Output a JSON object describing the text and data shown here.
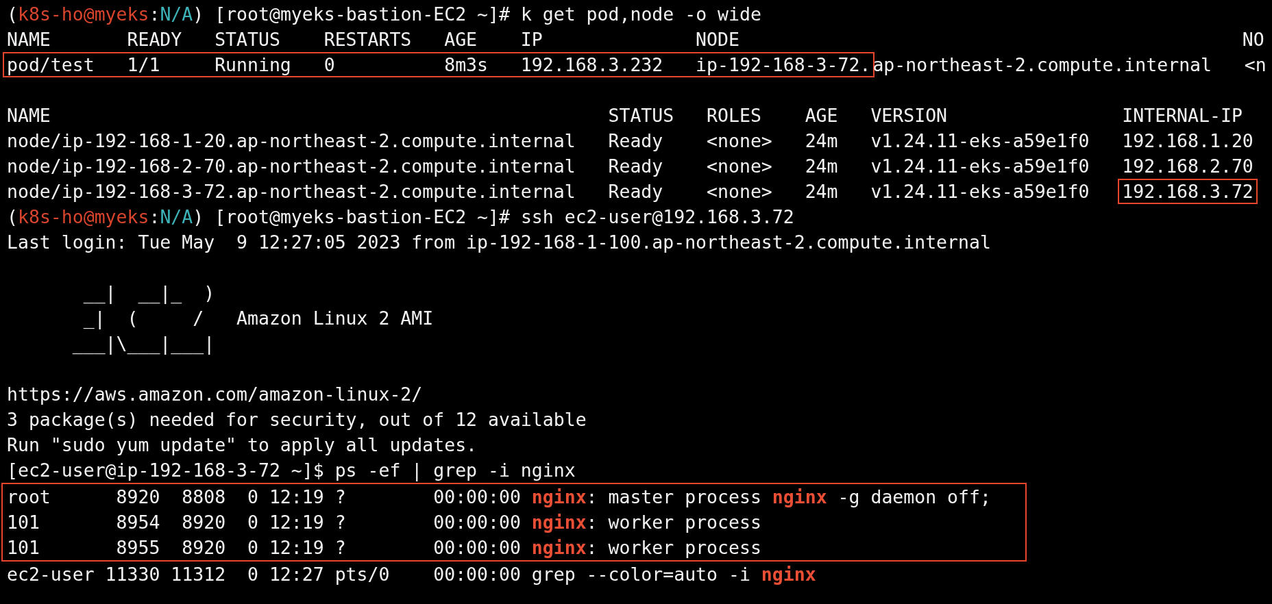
{
  "terminal": {
    "blocks": [
      {
        "kind": "line",
        "segments": [
          {
            "kind": "plain",
            "text": "("
          },
          {
            "kind": "user",
            "text": "k8s-ho@myeks"
          },
          {
            "kind": "plain",
            "text": ":"
          },
          {
            "kind": "context",
            "text": "N/A"
          },
          {
            "kind": "plain",
            "text": ") [root@myeks-bastion-EC2 ~]# k get pod,node -o wide"
          }
        ]
      },
      {
        "kind": "line",
        "segments": [
          {
            "kind": "plain",
            "text": "NAME       READY   STATUS    RESTARTS   AGE    IP              NODE                                              NO"
          }
        ]
      },
      {
        "kind": "line",
        "segments": [
          {
            "kind": "boxed",
            "text": "pod/test   1/1     Running   0          8m3s   192.168.3.232   ip-192-168-3-72."
          },
          {
            "kind": "plain",
            "text": "ap-northeast-2.compute.internal   <n"
          }
        ]
      },
      {
        "kind": "blank"
      },
      {
        "kind": "line",
        "segments": [
          {
            "kind": "plain",
            "text": "NAME                                                   STATUS   ROLES    AGE   VERSION                INTERNAL-IP"
          }
        ]
      },
      {
        "kind": "line",
        "segments": [
          {
            "kind": "plain",
            "text": "node/ip-192-168-1-20.ap-northeast-2.compute.internal   Ready    <none>   24m   v1.24.11-eks-a59e1f0   192.168.1.20"
          }
        ]
      },
      {
        "kind": "line",
        "segments": [
          {
            "kind": "plain",
            "text": "node/ip-192-168-2-70.ap-northeast-2.compute.internal   Ready    <none>   24m   v1.24.11-eks-a59e1f0   192.168.2.70"
          }
        ]
      },
      {
        "kind": "line",
        "segments": [
          {
            "kind": "plain",
            "text": "node/ip-192-168-3-72.ap-northeast-2.compute.internal   Ready    <none>   24m   v1.24.11-eks-a59e1f0   "
          },
          {
            "kind": "boxed",
            "text": "192.168.3.72"
          }
        ]
      },
      {
        "kind": "line",
        "segments": [
          {
            "kind": "plain",
            "text": "("
          },
          {
            "kind": "user",
            "text": "k8s-ho@myeks"
          },
          {
            "kind": "plain",
            "text": ":"
          },
          {
            "kind": "context",
            "text": "N/A"
          },
          {
            "kind": "plain",
            "text": ") [root@myeks-bastion-EC2 ~]# ssh ec2-user@192.168.3.72"
          }
        ]
      },
      {
        "kind": "line",
        "segments": [
          {
            "kind": "plain",
            "text": "Last login: Tue May  9 12:27:05 2023 from ip-192-168-1-100.ap-northeast-2.compute.internal"
          }
        ]
      },
      {
        "kind": "blank"
      },
      {
        "kind": "line",
        "segments": [
          {
            "kind": "plain",
            "text": "       __|  __|_  )"
          }
        ]
      },
      {
        "kind": "line",
        "segments": [
          {
            "kind": "plain",
            "text": "       _|  (     /   Amazon Linux 2 AMI"
          }
        ]
      },
      {
        "kind": "line",
        "segments": [
          {
            "kind": "plain",
            "text": "      ___|\\___|___|"
          }
        ]
      },
      {
        "kind": "blank"
      },
      {
        "kind": "line",
        "segments": [
          {
            "kind": "plain",
            "text": "https://aws.amazon.com/amazon-linux-2/"
          }
        ]
      },
      {
        "kind": "line",
        "segments": [
          {
            "kind": "plain",
            "text": "3 package(s) needed for security, out of 12 available"
          }
        ]
      },
      {
        "kind": "line",
        "segments": [
          {
            "kind": "plain",
            "text": "Run \"sudo yum update\" to apply all updates."
          }
        ]
      },
      {
        "kind": "line",
        "segments": [
          {
            "kind": "plain",
            "text": "[ec2-user@ip-192-168-3-72 ~]$ ps -ef | grep -i nginx"
          }
        ]
      },
      {
        "kind": "boxed_group",
        "lines": [
          {
            "segments": [
              {
                "kind": "plain",
                "text": "root      8920  8808  0 12:19 ?        00:00:00 "
              },
              {
                "kind": "match",
                "text": "nginx"
              },
              {
                "kind": "plain",
                "text": ": master process "
              },
              {
                "kind": "match",
                "text": "nginx"
              },
              {
                "kind": "plain",
                "text": " -g daemon off;"
              }
            ]
          },
          {
            "segments": [
              {
                "kind": "plain",
                "text": "101       8954  8920  0 12:19 ?        00:00:00 "
              },
              {
                "kind": "match",
                "text": "nginx"
              },
              {
                "kind": "plain",
                "text": ": worker process"
              }
            ]
          },
          {
            "segments": [
              {
                "kind": "plain",
                "text": "101       8955  8920  0 12:19 ?        00:00:00 "
              },
              {
                "kind": "match",
                "text": "nginx"
              },
              {
                "kind": "plain",
                "text": ": worker process"
              }
            ]
          }
        ]
      },
      {
        "kind": "line",
        "segments": [
          {
            "kind": "plain",
            "text": "ec2-user 11330 11312  0 12:27 pts/0    00:00:00 grep --color=auto -i "
          },
          {
            "kind": "match",
            "text": "nginx"
          }
        ]
      }
    ]
  }
}
